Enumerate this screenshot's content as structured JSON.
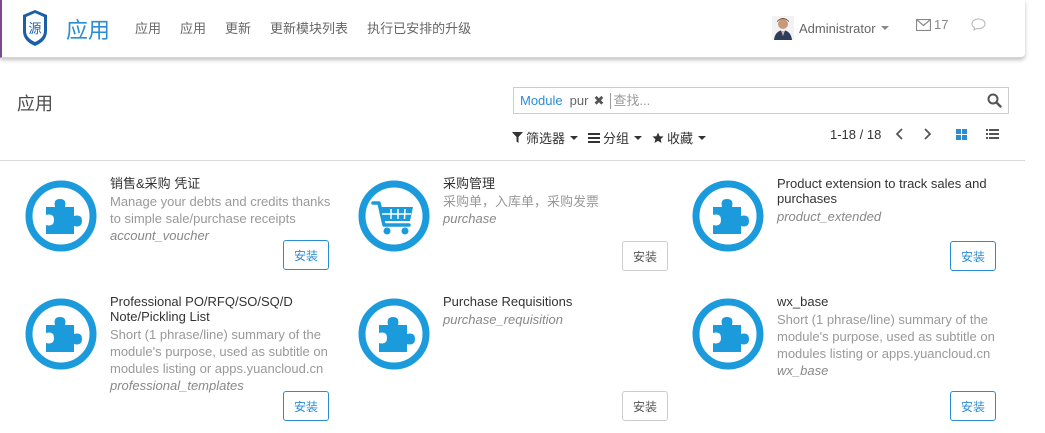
{
  "header": {
    "app_title": "应用",
    "menu": [
      "应用",
      "应用",
      "更新",
      "更新模块列表",
      "执行已安排的升级"
    ],
    "user_name": "Administrator",
    "mail_count": "17"
  },
  "control_panel": {
    "title": "应用",
    "search": {
      "facet_label": "Module",
      "facet_value": "pur",
      "facet_remove": "✖",
      "placeholder": "查找..."
    },
    "filters": [
      "筛选器",
      "分组",
      "收藏"
    ],
    "pager": "1-18 / 18"
  },
  "colors": {
    "accent": "#2a8dd4",
    "icon_blue": "#1c9bdc"
  },
  "modules": [
    {
      "name": "销售&采购 凭证",
      "summary": "Manage your debts and credits thanks to simple sale/purchase receipts",
      "technical": "account_voucher",
      "button": "安装",
      "button_style": "primary",
      "icon": "puzzle-icon"
    },
    {
      "name": "采购管理",
      "summary": "采购单，入库单，采购发票",
      "technical": "purchase",
      "button": "安装",
      "button_style": "default",
      "icon": "cart-icon"
    },
    {
      "name": "Product extension to track sales and purchases",
      "summary": "",
      "technical": "product_extended",
      "button": "安装",
      "button_style": "primary",
      "icon": "puzzle-icon"
    },
    {
      "name": "Professional PO/RFQ/SO/SQ/D Note/Pickling List",
      "summary": "Short (1 phrase/line) summary of the module's purpose, used as subtitle on modules listing or apps.yuancloud.cn",
      "technical": "professional_templates",
      "button": "安装",
      "button_style": "primary",
      "icon": "puzzle-icon"
    },
    {
      "name": "Purchase Requisitions",
      "summary": "",
      "technical": "purchase_requisition",
      "button": "安装",
      "button_style": "default",
      "icon": "puzzle-icon"
    },
    {
      "name": "wx_base",
      "summary": "Short (1 phrase/line) summary of the module's purpose, used as subtitle on modules listing or apps.yuancloud.cn",
      "technical": "wx_base",
      "button": "安装",
      "button_style": "primary",
      "icon": "puzzle-icon"
    }
  ]
}
